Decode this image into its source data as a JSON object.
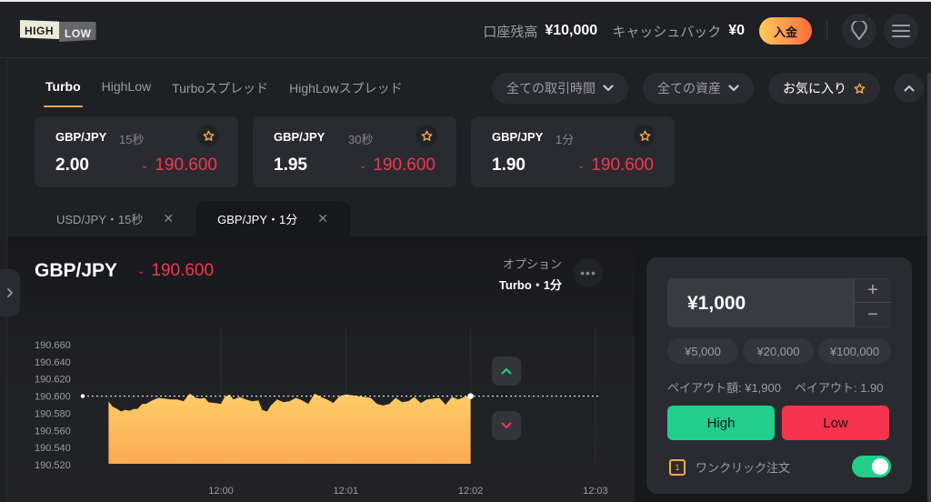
{
  "header": {
    "logo": {
      "high": "HIGH",
      "low": "LOW"
    },
    "balance_label": "口座残高",
    "balance_value": "¥10,000",
    "cashback_label": "キャッシュバック",
    "cashback_value": "¥0",
    "deposit_label": "入金",
    "icons": [
      "location-pin-icon",
      "hamburger-menu-icon"
    ]
  },
  "type_tabs": [
    {
      "label": "Turbo",
      "active": true
    },
    {
      "label": "HighLow",
      "active": false
    },
    {
      "label": "Turboスプレッド",
      "active": false
    },
    {
      "label": "HighLowスプレッド",
      "active": false
    }
  ],
  "filters": {
    "time": "全ての取引時間",
    "assets": "全ての資産",
    "favorites": "お気に入り"
  },
  "asset_cards": [
    {
      "pair": "GBP/JPY",
      "duration": "15秒",
      "payout": "2.00",
      "price": "190.600"
    },
    {
      "pair": "GBP/JPY",
      "duration": "30秒",
      "payout": "1.95",
      "price": "190.600"
    },
    {
      "pair": "GBP/JPY",
      "duration": "1分",
      "payout": "1.90",
      "price": "190.600"
    }
  ],
  "open_tabs": [
    {
      "label": "USD/JPY・15秒",
      "active": false
    },
    {
      "label": "GBP/JPY・1分",
      "active": true
    }
  ],
  "trade": {
    "asset": "GBP/JPY",
    "price": "190.600",
    "option_label": "オプション",
    "option_value": "Turbo・1分"
  },
  "order": {
    "amount": "¥1,000",
    "plus": "+",
    "minus": "−",
    "presets": [
      "¥5,000",
      "¥20,000",
      "¥100,000"
    ],
    "payout_amount": "ペイアウト額: ¥1,900",
    "payout_rate": "ペイアウト: 1.90",
    "high_label": "High",
    "low_label": "Low",
    "oneclick_label": "ワンクリック注文",
    "oneclick_icon_text": "1",
    "oneclick_enabled": true
  },
  "colors": {
    "accent": "#f7a948",
    "high": "#21cf8a",
    "low": "#f7344f",
    "price_down": "#f2364f",
    "area_top": "#ffcd67",
    "area_bottom": "#fba954"
  },
  "chart_data": {
    "type": "area",
    "title": "GBP/JPY",
    "xlabel": "",
    "ylabel": "",
    "y_ticks": [
      "190.660",
      "190.640",
      "190.620",
      "190.600",
      "190.580",
      "190.560",
      "190.540",
      "190.520"
    ],
    "x_ticks": [
      "12:00",
      "12:01",
      "12:02",
      "12:03"
    ],
    "ylim": [
      190.513,
      190.667
    ],
    "xlim_minutes": [
      -0.9,
      1.2
    ],
    "current_price": 190.6,
    "current_time_minutes": 2.0,
    "series": [
      {
        "name": "GBP/JPY",
        "t_minutes": [
          -0.9,
          -0.87,
          -0.83,
          -0.8,
          -0.77,
          -0.73,
          -0.7,
          -0.67,
          -0.63,
          -0.6,
          -0.55,
          -0.5,
          -0.45,
          -0.4,
          -0.35,
          -0.3,
          -0.25,
          -0.2,
          -0.17,
          -0.13,
          -0.1,
          -0.05,
          0.0,
          0.03,
          0.07,
          0.1,
          0.15,
          0.2,
          0.25,
          0.3,
          0.33,
          0.37,
          0.4,
          0.45,
          0.5,
          0.55,
          0.6,
          0.65,
          0.7,
          0.75,
          0.8,
          0.85,
          0.9,
          0.95,
          1.0,
          1.05,
          1.1,
          1.15,
          1.2,
          1.25,
          1.3,
          1.35,
          1.4,
          1.45,
          1.5,
          1.55,
          1.6,
          1.65,
          1.7,
          1.75,
          1.8,
          1.85,
          1.9,
          1.95,
          2.0
        ],
        "values": [
          190.594,
          190.588,
          190.585,
          190.582,
          190.584,
          190.583,
          190.585,
          190.585,
          190.591,
          190.591,
          190.595,
          190.598,
          190.597,
          190.596,
          190.596,
          190.594,
          190.603,
          190.598,
          190.597,
          190.598,
          190.593,
          190.592,
          190.591,
          190.599,
          190.602,
          190.596,
          190.599,
          190.596,
          190.594,
          190.595,
          190.584,
          190.582,
          190.589,
          190.596,
          190.593,
          190.594,
          190.598,
          190.595,
          190.591,
          190.603,
          190.599,
          190.596,
          190.592,
          190.6,
          190.602,
          190.601,
          190.6,
          190.599,
          190.598,
          190.591,
          190.589,
          190.591,
          190.598,
          190.593,
          190.594,
          190.599,
          190.592,
          190.596,
          190.597,
          190.598,
          190.59,
          190.599,
          190.596,
          190.599,
          190.6
        ]
      }
    ],
    "grid": true,
    "legend": "none"
  }
}
